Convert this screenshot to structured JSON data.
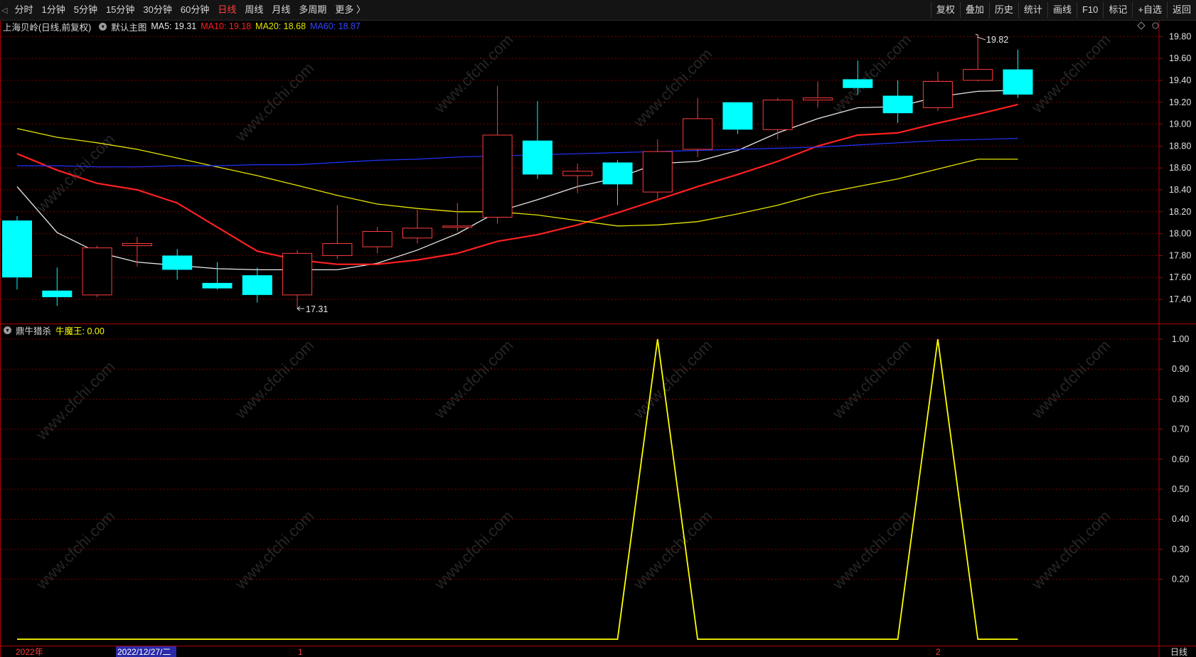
{
  "toolbar": {
    "periods": [
      "分时",
      "1分钟",
      "5分钟",
      "15分钟",
      "30分钟",
      "60分钟",
      "日线",
      "周线",
      "月线",
      "多周期",
      "更多 〉"
    ],
    "active_period": "日线",
    "buttons": [
      "复权",
      "叠加",
      "历史",
      "统计",
      "画线",
      "F10",
      "标记",
      "+自选",
      "返回"
    ]
  },
  "info": {
    "stock_title": "上海贝岭(日线,前复权)",
    "main_chart_label": "默认主图",
    "ma5": "MA5: 19.31",
    "ma10": "MA10: 19.18",
    "ma20": "MA20: 18.68",
    "ma60": "MA60: 18.87"
  },
  "indicator": {
    "name": "鼎牛猎杀",
    "value_label": "牛魔王: 0.00"
  },
  "colors": {
    "background": "#000000",
    "up": "#ff3b3b",
    "down": "#00ffff",
    "ma5": "#e8e8e8",
    "ma10": "#ff2020",
    "ma20": "#e6e600",
    "ma60": "#2233ff",
    "indicator": "#ffff00",
    "grid": "#7a0000"
  },
  "price_axis": [
    "19.80",
    "19.60",
    "19.40",
    "19.20",
    "19.00",
    "18.80",
    "18.60",
    "18.40",
    "18.20",
    "18.00",
    "17.80",
    "17.60",
    "17.40"
  ],
  "indicator_axis": [
    "1.00",
    "0.90",
    "0.80",
    "0.70",
    "0.60",
    "0.50",
    "0.40",
    "0.30",
    "0.20"
  ],
  "annotations": {
    "high": "19.82",
    "low": "17.31"
  },
  "date_axis": {
    "year": "2022年",
    "cursor_date": "2022/12/27/二",
    "m1": "1",
    "m2": "2"
  },
  "status": {
    "period": "日线"
  },
  "watermark": "www.cfchi.com",
  "chart_data": [
    {
      "type": "candlestick",
      "ylim": [
        17.3,
        19.85
      ],
      "candles": [
        {
          "o": 18.12,
          "h": 18.16,
          "l": 17.49,
          "c": 17.6
        },
        {
          "o": 17.48,
          "h": 17.69,
          "l": 17.34,
          "c": 17.42
        },
        {
          "o": 17.44,
          "h": 17.89,
          "l": 17.42,
          "c": 17.87
        },
        {
          "o": 17.89,
          "h": 17.97,
          "l": 17.7,
          "c": 17.91
        },
        {
          "o": 17.8,
          "h": 17.86,
          "l": 17.58,
          "c": 17.67
        },
        {
          "o": 17.55,
          "h": 17.74,
          "l": 17.49,
          "c": 17.5
        },
        {
          "o": 17.62,
          "h": 17.69,
          "l": 17.37,
          "c": 17.44
        },
        {
          "o": 17.44,
          "h": 17.85,
          "l": 17.31,
          "c": 17.82
        },
        {
          "o": 17.8,
          "h": 18.26,
          "l": 17.77,
          "c": 17.91
        },
        {
          "o": 17.88,
          "h": 18.06,
          "l": 17.82,
          "c": 18.02
        },
        {
          "o": 17.96,
          "h": 18.22,
          "l": 17.91,
          "c": 18.05
        },
        {
          "o": 18.07,
          "h": 18.28,
          "l": 18.02,
          "c": 18.07
        },
        {
          "o": 18.15,
          "h": 19.35,
          "l": 18.09,
          "c": 18.9
        },
        {
          "o": 18.85,
          "h": 19.21,
          "l": 18.5,
          "c": 18.54
        },
        {
          "o": 18.53,
          "h": 18.64,
          "l": 18.37,
          "c": 18.57
        },
        {
          "o": 18.65,
          "h": 18.67,
          "l": 18.26,
          "c": 18.45
        },
        {
          "o": 18.38,
          "h": 18.86,
          "l": 18.32,
          "c": 18.75
        },
        {
          "o": 18.77,
          "h": 19.24,
          "l": 18.7,
          "c": 19.05
        },
        {
          "o": 19.2,
          "h": 19.2,
          "l": 18.91,
          "c": 18.95
        },
        {
          "o": 18.95,
          "h": 19.24,
          "l": 18.86,
          "c": 19.22
        },
        {
          "o": 19.22,
          "h": 19.39,
          "l": 19.15,
          "c": 19.24
        },
        {
          "o": 19.41,
          "h": 19.58,
          "l": 19.27,
          "c": 19.33
        },
        {
          "o": 19.26,
          "h": 19.4,
          "l": 19.01,
          "c": 19.1
        },
        {
          "o": 19.15,
          "h": 19.48,
          "l": 19.12,
          "c": 19.39
        },
        {
          "o": 19.4,
          "h": 19.82,
          "l": 19.39,
          "c": 19.5
        },
        {
          "o": 19.5,
          "h": 19.68,
          "l": 19.24,
          "c": 19.27
        }
      ],
      "series": [
        {
          "name": "MA5",
          "values": [
            18.43,
            18.01,
            17.83,
            17.74,
            17.71,
            17.68,
            17.67,
            17.67,
            17.67,
            17.73,
            17.85,
            18,
            18.2,
            18.31,
            18.43,
            18.51,
            18.64,
            18.66,
            18.76,
            18.92,
            19.05,
            19.15,
            19.16,
            19.25,
            19.3,
            19.31
          ]
        },
        {
          "name": "MA10",
          "values": [
            18.73,
            18.58,
            18.46,
            18.4,
            18.28,
            18.06,
            17.84,
            17.76,
            17.72,
            17.72,
            17.76,
            17.82,
            17.93,
            17.99,
            18.08,
            18.19,
            18.31,
            18.43,
            18.54,
            18.66,
            18.8,
            18.9,
            18.92,
            19.01,
            19.09,
            19.18
          ]
        },
        {
          "name": "MA20",
          "values": [
            18.96,
            18.88,
            18.83,
            18.77,
            18.69,
            18.61,
            18.53,
            18.44,
            18.35,
            18.27,
            18.23,
            18.2,
            18.2,
            18.17,
            18.12,
            18.07,
            18.08,
            18.11,
            18.18,
            18.26,
            18.36,
            18.43,
            18.5,
            18.59,
            18.68,
            18.68
          ]
        },
        {
          "name": "MA60",
          "values": [
            18.62,
            18.62,
            18.61,
            18.61,
            18.62,
            18.62,
            18.63,
            18.63,
            18.65,
            18.67,
            18.68,
            18.7,
            18.71,
            18.72,
            18.73,
            18.74,
            18.75,
            18.76,
            18.77,
            18.78,
            18.79,
            18.81,
            18.83,
            18.85,
            18.86,
            18.87
          ]
        }
      ]
    },
    {
      "type": "line",
      "ylim": [
        0,
        1
      ],
      "series": [
        {
          "name": "牛魔王",
          "values": [
            0,
            0,
            0,
            0,
            0,
            0,
            0,
            0,
            0,
            0,
            0,
            0,
            0,
            0,
            0,
            0,
            1,
            0,
            0,
            0,
            0,
            0,
            0,
            1,
            0,
            0
          ]
        }
      ]
    }
  ]
}
